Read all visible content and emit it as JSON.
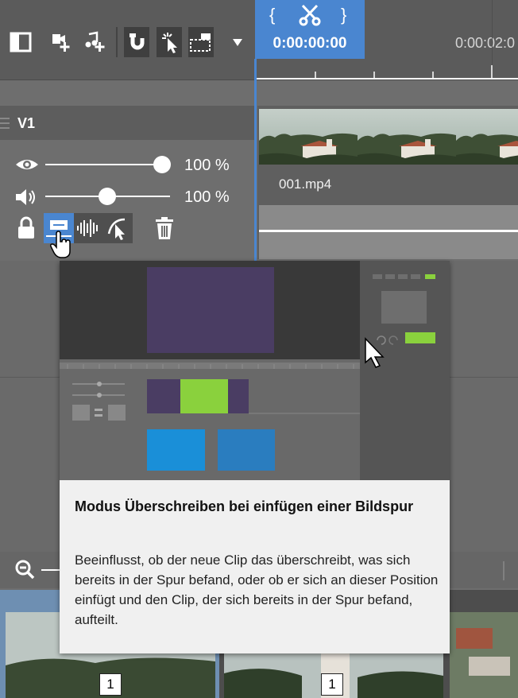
{
  "timeline": {
    "playhead_time": "0:00:00:00",
    "ruler_time_2": "0:00:02:0"
  },
  "track": {
    "name": "V1",
    "visibility_percent": "100 %",
    "visibility_level": 1.0,
    "volume_percent": "100 %",
    "volume_level": 0.5
  },
  "clip": {
    "filename": "001.mp4"
  },
  "tooltip": {
    "title": "Modus Überschreiben bei einfügen einer Bildspur",
    "body": "Beeinflusst, ob der neue Clip das überschreibt, was sich bereits in der Spur befand, oder ob er sich an dieser Position einfügt und den Clip, der sich bereits in der Spur befand, aufteilt."
  },
  "media_strip": {
    "badges": [
      "1",
      "1"
    ]
  },
  "colors": {
    "accent": "#4a86d0",
    "preview_purple": "#4a3d63",
    "preview_green": "#8ad13d",
    "preview_blue": "#1a8fd8"
  },
  "icons": [
    "panel-toggle-icon",
    "add-video-track-icon",
    "add-audio-track-icon",
    "magnet-icon",
    "select-icon",
    "range-select-icon",
    "dropdown-arrow-icon",
    "scissors-icon",
    "eye-icon",
    "speaker-icon",
    "lock-icon",
    "overwrite-mode-icon",
    "audio-wave-icon",
    "automation-icon",
    "trash-icon",
    "hand-cursor-icon",
    "zoom-out-icon",
    "drag-handle-icon"
  ]
}
